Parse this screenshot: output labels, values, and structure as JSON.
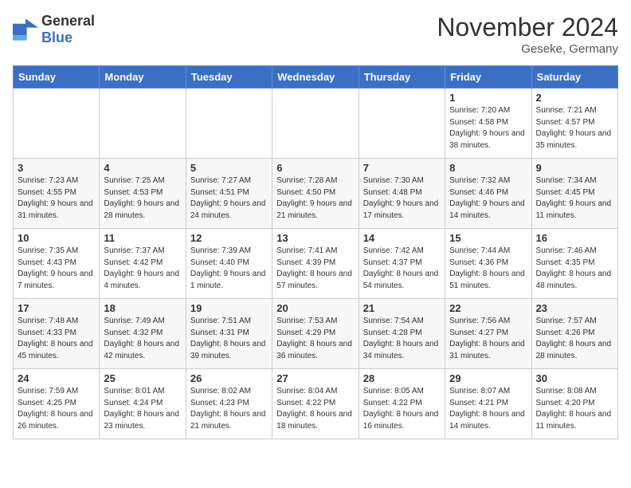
{
  "logo": {
    "general": "General",
    "blue": "Blue"
  },
  "header": {
    "month": "November 2024",
    "location": "Geseke, Germany"
  },
  "weekdays": [
    "Sunday",
    "Monday",
    "Tuesday",
    "Wednesday",
    "Thursday",
    "Friday",
    "Saturday"
  ],
  "weeks": [
    [
      {
        "day": "",
        "sunrise": "",
        "sunset": "",
        "daylight": ""
      },
      {
        "day": "",
        "sunrise": "",
        "sunset": "",
        "daylight": ""
      },
      {
        "day": "",
        "sunrise": "",
        "sunset": "",
        "daylight": ""
      },
      {
        "day": "",
        "sunrise": "",
        "sunset": "",
        "daylight": ""
      },
      {
        "day": "",
        "sunrise": "",
        "sunset": "",
        "daylight": ""
      },
      {
        "day": "1",
        "sunrise": "Sunrise: 7:20 AM",
        "sunset": "Sunset: 4:58 PM",
        "daylight": "Daylight: 9 hours and 38 minutes."
      },
      {
        "day": "2",
        "sunrise": "Sunrise: 7:21 AM",
        "sunset": "Sunset: 4:57 PM",
        "daylight": "Daylight: 9 hours and 35 minutes."
      }
    ],
    [
      {
        "day": "3",
        "sunrise": "Sunrise: 7:23 AM",
        "sunset": "Sunset: 4:55 PM",
        "daylight": "Daylight: 9 hours and 31 minutes."
      },
      {
        "day": "4",
        "sunrise": "Sunrise: 7:25 AM",
        "sunset": "Sunset: 4:53 PM",
        "daylight": "Daylight: 9 hours and 28 minutes."
      },
      {
        "day": "5",
        "sunrise": "Sunrise: 7:27 AM",
        "sunset": "Sunset: 4:51 PM",
        "daylight": "Daylight: 9 hours and 24 minutes."
      },
      {
        "day": "6",
        "sunrise": "Sunrise: 7:28 AM",
        "sunset": "Sunset: 4:50 PM",
        "daylight": "Daylight: 9 hours and 21 minutes."
      },
      {
        "day": "7",
        "sunrise": "Sunrise: 7:30 AM",
        "sunset": "Sunset: 4:48 PM",
        "daylight": "Daylight: 9 hours and 17 minutes."
      },
      {
        "day": "8",
        "sunrise": "Sunrise: 7:32 AM",
        "sunset": "Sunset: 4:46 PM",
        "daylight": "Daylight: 9 hours and 14 minutes."
      },
      {
        "day": "9",
        "sunrise": "Sunrise: 7:34 AM",
        "sunset": "Sunset: 4:45 PM",
        "daylight": "Daylight: 9 hours and 11 minutes."
      }
    ],
    [
      {
        "day": "10",
        "sunrise": "Sunrise: 7:35 AM",
        "sunset": "Sunset: 4:43 PM",
        "daylight": "Daylight: 9 hours and 7 minutes."
      },
      {
        "day": "11",
        "sunrise": "Sunrise: 7:37 AM",
        "sunset": "Sunset: 4:42 PM",
        "daylight": "Daylight: 9 hours and 4 minutes."
      },
      {
        "day": "12",
        "sunrise": "Sunrise: 7:39 AM",
        "sunset": "Sunset: 4:40 PM",
        "daylight": "Daylight: 9 hours and 1 minute."
      },
      {
        "day": "13",
        "sunrise": "Sunrise: 7:41 AM",
        "sunset": "Sunset: 4:39 PM",
        "daylight": "Daylight: 8 hours and 57 minutes."
      },
      {
        "day": "14",
        "sunrise": "Sunrise: 7:42 AM",
        "sunset": "Sunset: 4:37 PM",
        "daylight": "Daylight: 8 hours and 54 minutes."
      },
      {
        "day": "15",
        "sunrise": "Sunrise: 7:44 AM",
        "sunset": "Sunset: 4:36 PM",
        "daylight": "Daylight: 8 hours and 51 minutes."
      },
      {
        "day": "16",
        "sunrise": "Sunrise: 7:46 AM",
        "sunset": "Sunset: 4:35 PM",
        "daylight": "Daylight: 8 hours and 48 minutes."
      }
    ],
    [
      {
        "day": "17",
        "sunrise": "Sunrise: 7:48 AM",
        "sunset": "Sunset: 4:33 PM",
        "daylight": "Daylight: 8 hours and 45 minutes."
      },
      {
        "day": "18",
        "sunrise": "Sunrise: 7:49 AM",
        "sunset": "Sunset: 4:32 PM",
        "daylight": "Daylight: 8 hours and 42 minutes."
      },
      {
        "day": "19",
        "sunrise": "Sunrise: 7:51 AM",
        "sunset": "Sunset: 4:31 PM",
        "daylight": "Daylight: 8 hours and 39 minutes."
      },
      {
        "day": "20",
        "sunrise": "Sunrise: 7:53 AM",
        "sunset": "Sunset: 4:29 PM",
        "daylight": "Daylight: 8 hours and 36 minutes."
      },
      {
        "day": "21",
        "sunrise": "Sunrise: 7:54 AM",
        "sunset": "Sunset: 4:28 PM",
        "daylight": "Daylight: 8 hours and 34 minutes."
      },
      {
        "day": "22",
        "sunrise": "Sunrise: 7:56 AM",
        "sunset": "Sunset: 4:27 PM",
        "daylight": "Daylight: 8 hours and 31 minutes."
      },
      {
        "day": "23",
        "sunrise": "Sunrise: 7:57 AM",
        "sunset": "Sunset: 4:26 PM",
        "daylight": "Daylight: 8 hours and 28 minutes."
      }
    ],
    [
      {
        "day": "24",
        "sunrise": "Sunrise: 7:59 AM",
        "sunset": "Sunset: 4:25 PM",
        "daylight": "Daylight: 8 hours and 26 minutes."
      },
      {
        "day": "25",
        "sunrise": "Sunrise: 8:01 AM",
        "sunset": "Sunset: 4:24 PM",
        "daylight": "Daylight: 8 hours and 23 minutes."
      },
      {
        "day": "26",
        "sunrise": "Sunrise: 8:02 AM",
        "sunset": "Sunset: 4:23 PM",
        "daylight": "Daylight: 8 hours and 21 minutes."
      },
      {
        "day": "27",
        "sunrise": "Sunrise: 8:04 AM",
        "sunset": "Sunset: 4:22 PM",
        "daylight": "Daylight: 8 hours and 18 minutes."
      },
      {
        "day": "28",
        "sunrise": "Sunrise: 8:05 AM",
        "sunset": "Sunset: 4:22 PM",
        "daylight": "Daylight: 8 hours and 16 minutes."
      },
      {
        "day": "29",
        "sunrise": "Sunrise: 8:07 AM",
        "sunset": "Sunset: 4:21 PM",
        "daylight": "Daylight: 8 hours and 14 minutes."
      },
      {
        "day": "30",
        "sunrise": "Sunrise: 8:08 AM",
        "sunset": "Sunset: 4:20 PM",
        "daylight": "Daylight: 8 hours and 11 minutes."
      }
    ]
  ]
}
